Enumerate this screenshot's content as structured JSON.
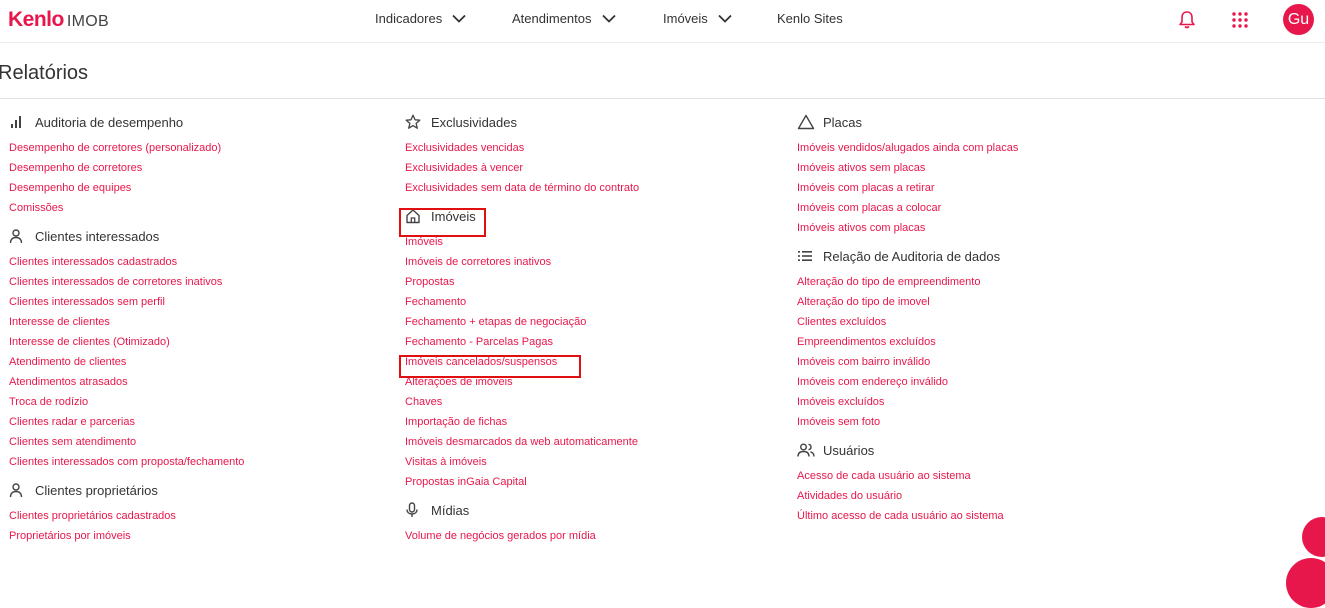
{
  "app": {
    "brand": "Kenlo",
    "product": "IMOB"
  },
  "nav": [
    {
      "label": "Indicadores",
      "has_dropdown": true
    },
    {
      "label": "Atendimentos",
      "has_dropdown": true
    },
    {
      "label": "Imóveis",
      "has_dropdown": true
    },
    {
      "label": "Kenlo Sites",
      "has_dropdown": false
    }
  ],
  "user": {
    "initials": "Gu"
  },
  "page": {
    "title": "Relatórios"
  },
  "colors": {
    "accent": "#e8174b",
    "highlight_box": "#e01010"
  },
  "columns": [
    [
      {
        "title": "Auditoria de desempenho",
        "icon": "bar-chart-icon",
        "links": [
          "Desempenho de corretores (personalizado)",
          "Desempenho de corretores",
          "Desempenho de equipes",
          "Comissões"
        ]
      },
      {
        "title": "Clientes interessados",
        "icon": "person-icon",
        "links": [
          "Clientes interessados cadastrados",
          "Clientes interessados de corretores inativos",
          "Clientes interessados sem perfil",
          "Interesse de clientes",
          "Interesse de clientes (Otimizado)",
          "Atendimento de clientes",
          "Atendimentos atrasados",
          "Troca de rodízio",
          "Clientes radar e parcerias",
          "Clientes sem atendimento",
          "Clientes interessados com proposta/fechamento"
        ]
      },
      {
        "title": "Clientes proprietários",
        "icon": "person-icon",
        "links": [
          "Clientes proprietários cadastrados",
          "Proprietários por imóveis"
        ]
      }
    ],
    [
      {
        "title": "Exclusividades",
        "icon": "star-icon",
        "links": [
          "Exclusividades vencidas",
          "Exclusividades à vencer",
          "Exclusividades sem data de término do contrato"
        ]
      },
      {
        "title": "Imóveis",
        "icon": "home-icon",
        "links": [
          "Imóveis",
          "Imóveis de corretores inativos",
          "Propostas",
          "Fechamento",
          "Fechamento + etapas de negociação",
          "Fechamento - Parcelas Pagas",
          "Imóveis cancelados/suspensos",
          "Alterações de imóveis",
          "Chaves",
          "Importação de fichas",
          "Imóveis desmarcados da web automaticamente",
          "Visitas à imóveis",
          "Propostas inGaia Capital"
        ]
      },
      {
        "title": "Mídias",
        "icon": "microphone-icon",
        "links": [
          "Volume de negócios gerados por mídia"
        ]
      }
    ],
    [
      {
        "title": "Placas",
        "icon": "triangle-icon",
        "links": [
          "Imóveis vendidos/alugados ainda com placas",
          "Imóveis ativos sem placas",
          "Imóveis com placas a retirar",
          "Imóveis com placas a colocar",
          "Imóveis ativos com placas"
        ]
      },
      {
        "title": "Relação de Auditoria de dados",
        "icon": "list-icon",
        "links": [
          "Alteração do tipo de empreendimento",
          "Alteração do tipo de imovel",
          "Clientes excluídos",
          "Empreendimentos excluídos",
          "Imóveis com bairro inválido",
          "Imóveis com endereço inválido",
          "Imóveis excluídos",
          "Imóveis sem foto"
        ]
      },
      {
        "title": "Usuários",
        "icon": "users-icon",
        "links": [
          "Acesso de cada usuário ao sistema",
          "Atividades do usuário",
          "Último acesso de cada usuário ao sistema"
        ]
      }
    ]
  ]
}
